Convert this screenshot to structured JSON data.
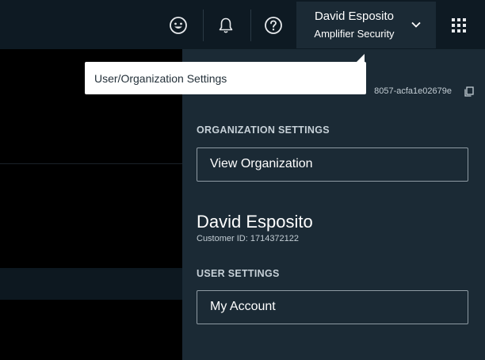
{
  "header": {
    "icons": {
      "feedback": "smiley-icon",
      "notifications": "bell-icon",
      "help": "help-icon",
      "apps": "app-grid-icon",
      "user_menu_chevron": "chevron-down-icon"
    },
    "user_menu": {
      "name": "David Esposito",
      "organization": "Amplifier Security"
    }
  },
  "tooltip": {
    "text": "User/Organization Settings"
  },
  "panel": {
    "org_id_tail": "8057-acfa1e02679e",
    "copy_icon": "copy-icon",
    "organization_settings_title": "ORGANIZATION SETTINGS",
    "view_organization_label": "View Organization",
    "customer_name": "David Esposito",
    "customer_id": "Customer ID: 1714372122",
    "user_settings_title": "USER SETTINGS",
    "my_account_label": "My Account"
  },
  "colors": {
    "topbar_bg": "#0e1a23",
    "panel_bg": "#1b2a35",
    "page_bg": "#000000",
    "tooltip_bg": "#ffffff",
    "button_border": "#8e9aa3"
  }
}
